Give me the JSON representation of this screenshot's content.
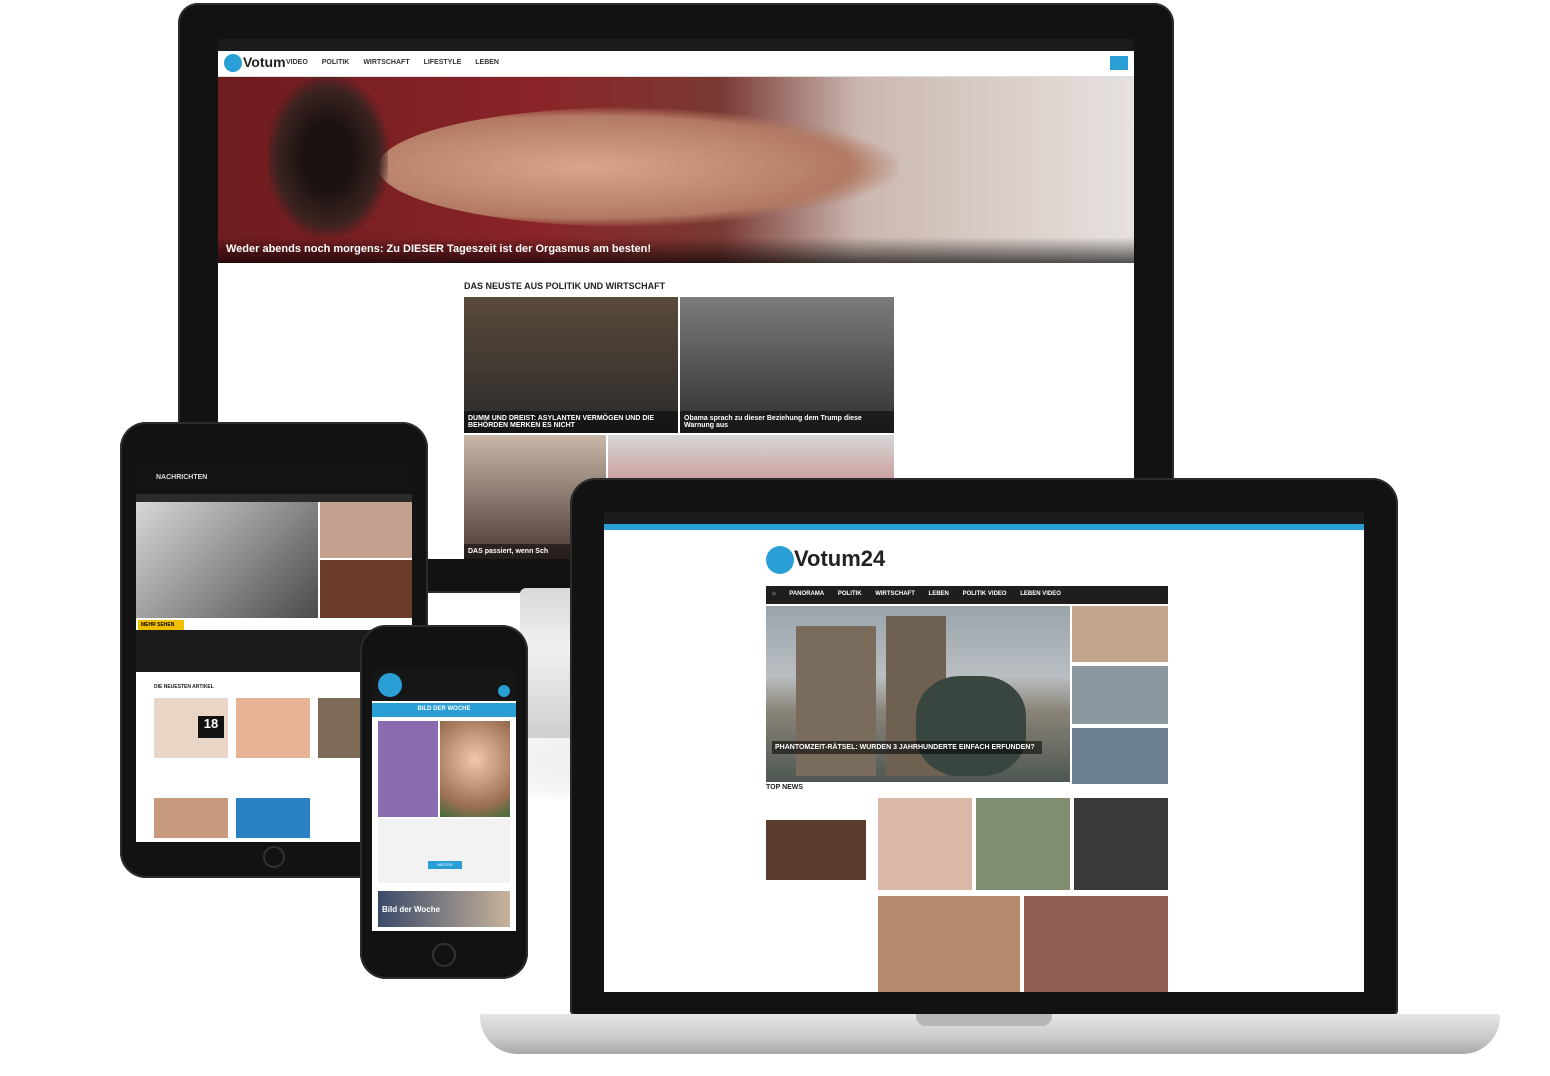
{
  "monitor": {
    "nav": [
      "VIDEO",
      "POLITIK",
      "WIRTSCHAFT",
      "LIFESTYLE",
      "LEBEN"
    ],
    "logo": "Votum",
    "hero_caption": "Weder abends noch morgens: Zu DIESER Tageszeit ist der Orgasmus am besten!",
    "section_title": "DAS NEUSTE AUS POLITIK UND WIRTSCHAFT",
    "cards": [
      {
        "title": "DUMM UND DREIST: ASYLANTEN VERMÖGEN UND DIE BEHÖRDEN MERKEN ES NICHT"
      },
      {
        "title": "Obama sprach zu dieser Beziehung dem Trump diese Warnung aus"
      },
      {
        "title": "DAS passiert, wenn Sch"
      }
    ]
  },
  "tablet": {
    "brand": "NACHRICHTEN",
    "badge": "MEHR SEHEN",
    "section": "DIE NEUESTEN ARTIKEL",
    "number": "18"
  },
  "phone": {
    "banner": "BILD DER WOCHE",
    "card_title": "Bild der Woche",
    "cta": "WEITER"
  },
  "laptop": {
    "logo": "Votum24",
    "nav": [
      "PANORAMA",
      "POLITIK",
      "WIRTSCHAFT",
      "LEBEN",
      "POLITIK VIDEO",
      "LEBEN VIDEO"
    ],
    "hero_caption": "PHANTOMZEIT-RÄTSEL: WURDEN 3 JAHRHUNDERTE EINFACH ERFUNDEN?",
    "top_news": "TOP NEWS"
  }
}
